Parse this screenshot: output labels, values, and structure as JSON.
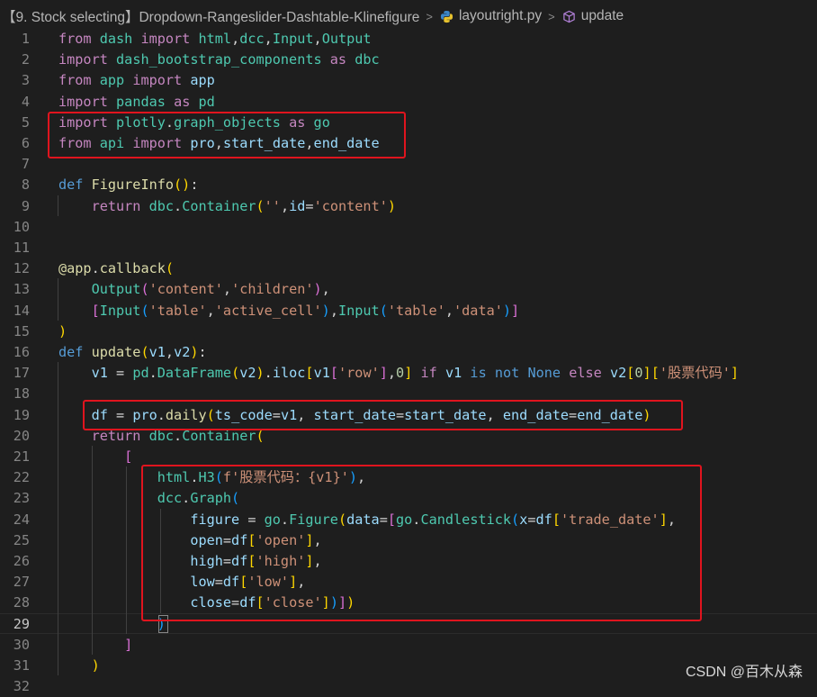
{
  "breadcrumb": {
    "folder": "【9. Stock selecting】Dropdown-Rangeslider-Dashtable-Klinefigure",
    "file": "layoutright.py",
    "symbol": "update"
  },
  "line_numbers": [
    "1",
    "2",
    "3",
    "4",
    "5",
    "6",
    "7",
    "8",
    "9",
    "10",
    "11",
    "12",
    "13",
    "14",
    "15",
    "16",
    "17",
    "18",
    "19",
    "20",
    "21",
    "22",
    "23",
    "24",
    "25",
    "26",
    "27",
    "28",
    "29",
    "30",
    "31",
    "32"
  ],
  "code_text": {
    "l17_label": "'股票代码'",
    "l22_label": "f'股票代码：{v1}'"
  },
  "watermark": "CSDN @百木从森"
}
